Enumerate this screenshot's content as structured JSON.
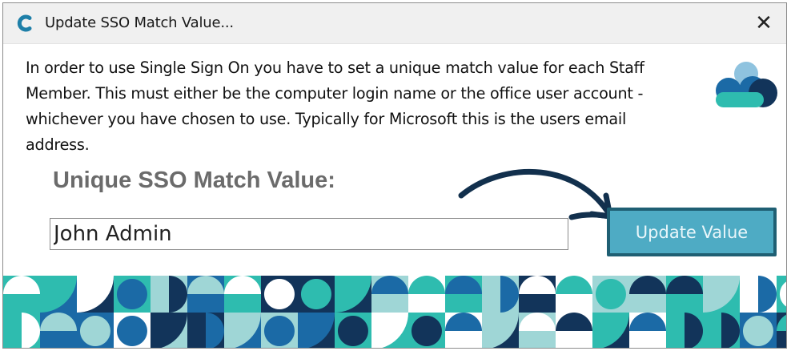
{
  "window": {
    "title": "Update SSO Match Value...",
    "close_glyph": "✕"
  },
  "message": "In order to use Single Sign On you have to set a unique match value for each Staff Member.  This must either be the computer login name or the office user account - whichever you have chosen to use.  Typically for Microsoft this is the users email address.",
  "form": {
    "label": "Unique SSO Match Value:",
    "value": "John Admin",
    "button_label": "Update Value"
  },
  "icons": {
    "app": "c-logo-icon",
    "brand": "cloud-logo-icon",
    "arrow": "curved-arrow-icon",
    "close": "close-icon"
  },
  "colors": {
    "navy": "#12345a",
    "blue": "#1b6aa6",
    "teal": "#2ebcaf",
    "light_teal": "#9fd6d6",
    "button": "#4eabc4",
    "button_border": "#1f5f73",
    "label": "#6b6b6b"
  }
}
